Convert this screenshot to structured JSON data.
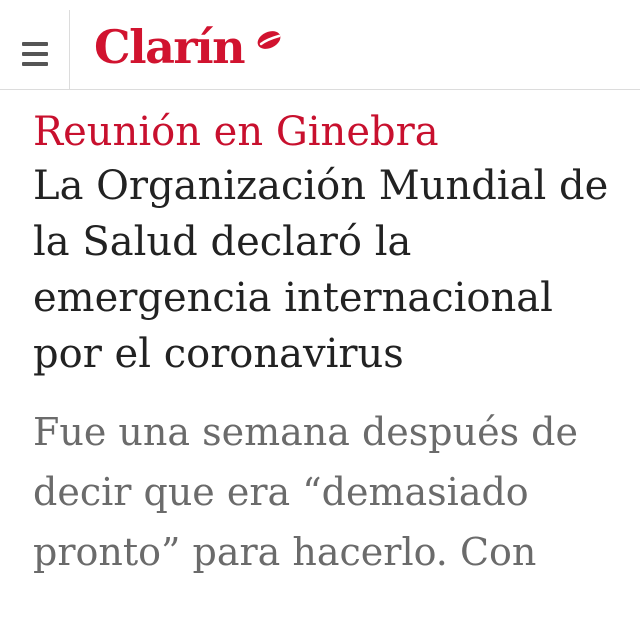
{
  "header": {
    "menu_icon": "hamburger-menu-icon",
    "brand": "Clarín",
    "brand_color": "#d1132f"
  },
  "article": {
    "kicker": "Reunión en Ginebra",
    "kicker_color": "#c8102e",
    "headline": "La Organización Mundial de la Salud declaró la emergencia internacional por el coronavirus",
    "summary": "Fue una semana después de decir que era “demasiado pronto” para hacerlo. Con"
  }
}
